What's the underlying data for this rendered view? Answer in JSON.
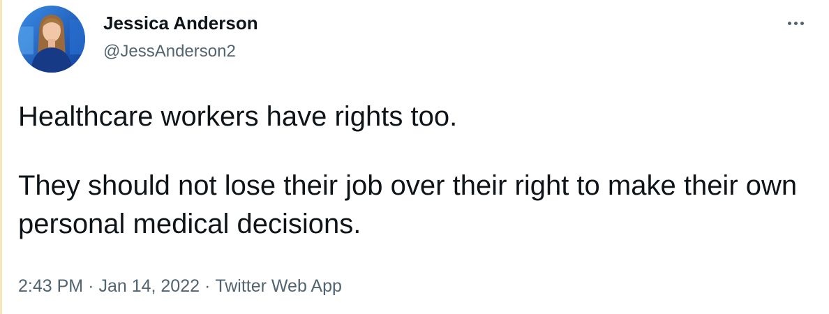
{
  "author": {
    "display_name": "Jessica Anderson",
    "handle": "@JessAnderson2",
    "avatar_icon": "profile-photo"
  },
  "more_icon": "more-horizontal-icon",
  "tweet": {
    "paragraphs": [
      "Healthcare workers have rights too.",
      "They should not lose their job over their right to make their own personal medical decisions."
    ]
  },
  "meta": {
    "time": "2:43 PM",
    "separator": "·",
    "date": "Jan 14, 2022",
    "source": "Twitter Web App"
  },
  "colors": {
    "text_primary": "#0f1419",
    "text_secondary": "#536471",
    "avatar_background": "#1d63c8",
    "left_border": "#f6e7b8"
  }
}
